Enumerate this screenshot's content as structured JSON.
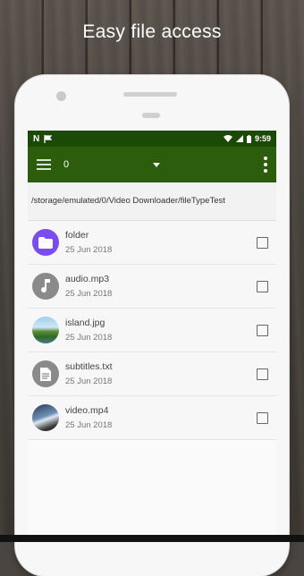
{
  "headline": "Easy file access",
  "status_bar": {
    "time": "9:59"
  },
  "toolbar": {
    "spinner_value": "0"
  },
  "path": "/storage/emulated/0/Video Downloader/fileTypeTest",
  "files": [
    {
      "name": "folder",
      "date": "25 Jun 2018",
      "icon": "folder-icon"
    },
    {
      "name": "audio.mp3",
      "date": "25 Jun 2018",
      "icon": "music-note-icon"
    },
    {
      "name": "island.jpg",
      "date": "25 Jun 2018",
      "icon": "image-thumbnail"
    },
    {
      "name": "subtitles.txt",
      "date": "25 Jun 2018",
      "icon": "text-file-icon"
    },
    {
      "name": "video.mp4",
      "date": "25 Jun 2018",
      "icon": "video-thumbnail"
    }
  ],
  "colors": {
    "status_bar": "#1a4a06",
    "toolbar": "#2b5d0d",
    "folder_accent": "#7b4df0"
  }
}
